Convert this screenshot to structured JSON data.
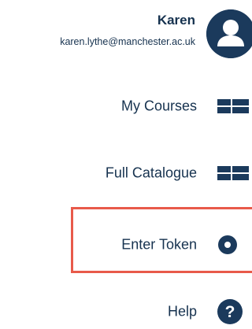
{
  "user": {
    "name": "Karen",
    "email": "karen.lythe@manchester.ac.uk",
    "avatar_icon": "user-icon"
  },
  "menu": {
    "items": [
      {
        "label": "My Courses",
        "icon": "grid-icon"
      },
      {
        "label": "Full Catalogue",
        "icon": "grid-icon"
      },
      {
        "label": "Enter Token",
        "icon": "dot-circle-icon",
        "highlighted": true
      },
      {
        "label": "Help",
        "icon": "question-icon"
      }
    ]
  },
  "colors": {
    "text": "#16324f",
    "icon": "#1b3a5c",
    "highlight": "#e85a4a",
    "background": "#ffffff"
  }
}
